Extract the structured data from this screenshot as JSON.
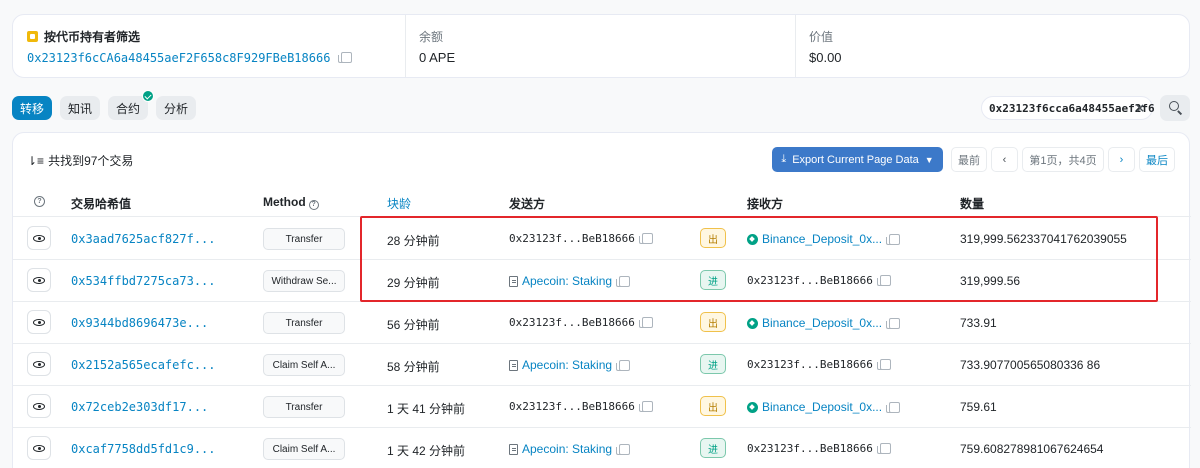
{
  "summary": {
    "filter_title": "按代币持有者筛选",
    "filter_address": "0x23123f6cCA6a48455aeF2F658c8F929FBeB18666",
    "balance_label": "余额",
    "balance_value": "0 APE",
    "value_label": "价值",
    "value_value": "$0.00"
  },
  "tabs": [
    {
      "label": "转移",
      "active": true
    },
    {
      "label": "知讯",
      "active": false
    },
    {
      "label": "合约",
      "active": false,
      "verified": true
    },
    {
      "label": "分析",
      "active": false
    }
  ],
  "filter_chip": {
    "text": "0x23123f6cca6a48455aef2f6",
    "close": "×"
  },
  "table": {
    "count_text": "共找到97个交易",
    "export_label": "Export Current Page Data",
    "pagination": {
      "first": "最前",
      "prev": "‹",
      "current": "第1页，共4页",
      "next": "›",
      "last": "最后"
    },
    "headers": {
      "hash": "交易哈希值",
      "method": "Method",
      "age": "块龄",
      "from": "发送方",
      "to": "接收方",
      "amount": "数量"
    },
    "rows": [
      {
        "hash": "0x3aad7625acf827f...",
        "method": "Transfer",
        "age": "28 分钟前",
        "from": "0x23123f...BeB18666",
        "from_is_contract": false,
        "direction": "出",
        "dir_type": "out",
        "to": "Binance_Deposit_0x...",
        "to_is_exchange": true,
        "amount": "319,999.562337041762039055"
      },
      {
        "hash": "0x534ffbd7275ca73...",
        "method": "Withdraw Se...",
        "age": "29 分钟前",
        "from": "Apecoin: Staking",
        "from_is_contract": true,
        "direction": "进",
        "dir_type": "in",
        "to": "0x23123f...BeB18666",
        "to_is_exchange": false,
        "amount": "319,999.56"
      },
      {
        "hash": "0x9344bd8696473e...",
        "method": "Transfer",
        "age": "56 分钟前",
        "from": "0x23123f...BeB18666",
        "from_is_contract": false,
        "direction": "出",
        "dir_type": "out",
        "to": "Binance_Deposit_0x...",
        "to_is_exchange": true,
        "amount": "733.91"
      },
      {
        "hash": "0x2152a565ecafefc...",
        "method": "Claim Self A...",
        "age": "58 分钟前",
        "from": "Apecoin: Staking",
        "from_is_contract": true,
        "direction": "进",
        "dir_type": "in",
        "to": "0x23123f...BeB18666",
        "to_is_exchange": false,
        "amount": "733.907700565080336 86"
      },
      {
        "hash": "0x72ceb2e303df17...",
        "method": "Transfer",
        "age": "1 天 41 分钟前",
        "from": "0x23123f...BeB18666",
        "from_is_contract": false,
        "direction": "出",
        "dir_type": "out",
        "to": "Binance_Deposit_0x...",
        "to_is_exchange": true,
        "amount": "759.61"
      },
      {
        "hash": "0xcaf7758dd5fd1c9...",
        "method": "Claim Self A...",
        "age": "1 天 42 分钟前",
        "from": "Apecoin: Staking",
        "from_is_contract": true,
        "direction": "进",
        "dir_type": "in",
        "to": "0x23123f...BeB18666",
        "to_is_exchange": false,
        "amount": "759.608278981067624654"
      }
    ]
  },
  "colors": {
    "accent": "#0784c3",
    "highlight": "#e3262b",
    "out_badge": "#f0c14b",
    "in_badge": "#00a186"
  }
}
